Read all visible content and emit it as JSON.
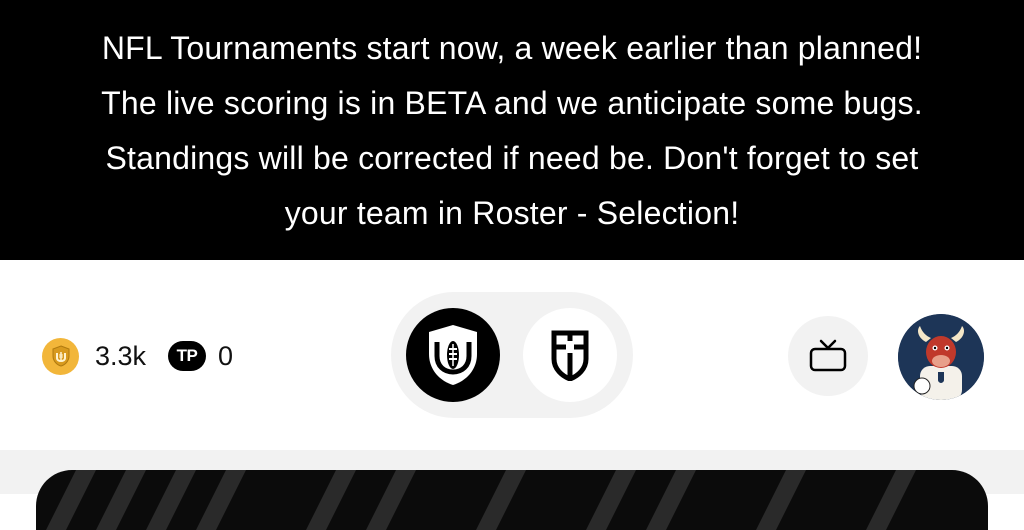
{
  "announcement": {
    "lines": [
      "NFL Tournaments start now, a week earlier than planned!",
      "The live scoring is in BETA and we anticipate some bugs.",
      "Standings will be corrected if need be. Don't forget to set",
      "your team in Roster - Selection!"
    ]
  },
  "header": {
    "coins": {
      "icon": "shield-coin-icon",
      "value": "3.3k"
    },
    "tp": {
      "badge": "TP",
      "value": "0"
    },
    "modes": [
      {
        "icon": "football-shield-icon",
        "active": true
      },
      {
        "icon": "soccer-shield-icon",
        "active": false
      }
    ],
    "tv_icon": "tv-icon",
    "avatar_icon": "bull-mascot-avatar"
  },
  "colors": {
    "banner_bg": "#000000",
    "coin": "#f2b63a",
    "pill_bg": "#f2f2f2"
  }
}
